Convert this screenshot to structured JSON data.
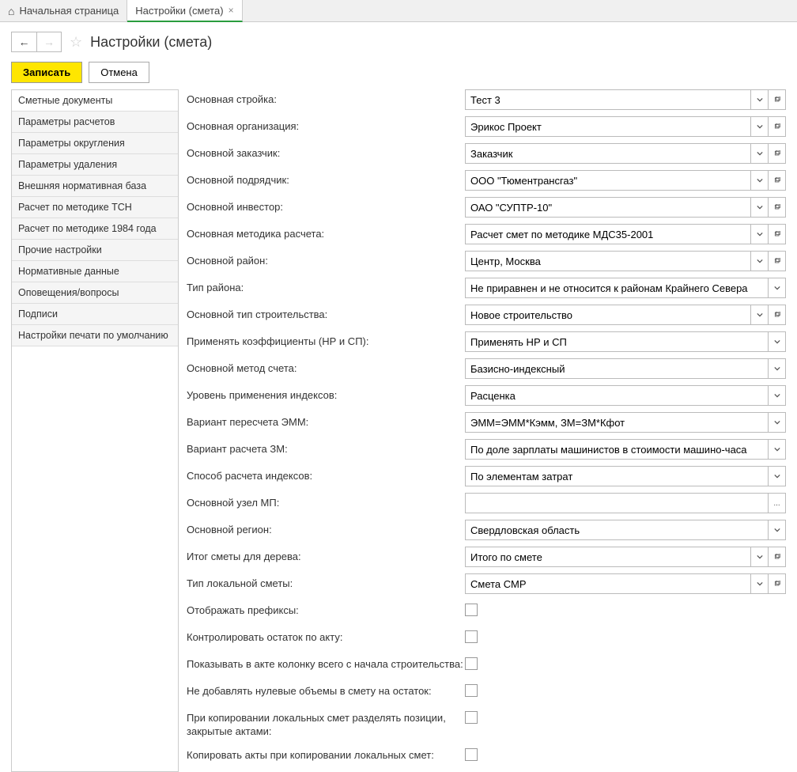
{
  "tabs": [
    {
      "label": "Начальная страница",
      "icon": "home"
    },
    {
      "label": "Настройки (смета)",
      "closable": true,
      "active": true
    }
  ],
  "pageTitle": "Настройки (смета)",
  "buttons": {
    "save": "Записать",
    "cancel": "Отмена"
  },
  "sidebar": [
    {
      "label": "Сметные документы",
      "active": true
    },
    {
      "label": "Параметры расчетов"
    },
    {
      "label": "Параметры округления"
    },
    {
      "label": "Параметры удаления"
    },
    {
      "label": "Внешняя нормативная база"
    },
    {
      "label": "Расчет по методике ТСН"
    },
    {
      "label": "Расчет по методике 1984 года"
    },
    {
      "label": "Прочие настройки"
    },
    {
      "label": "Нормативные данные"
    },
    {
      "label": "Оповещения/вопросы"
    },
    {
      "label": "Подписи"
    },
    {
      "label": "Настройки печати по умолчанию"
    }
  ],
  "fields": [
    {
      "label": "Основная стройка:",
      "value": "Тест 3",
      "type": "ref"
    },
    {
      "label": "Основная организация:",
      "value": "Эрикос Проект",
      "type": "ref"
    },
    {
      "label": "Основной заказчик:",
      "value": "Заказчик",
      "type": "ref"
    },
    {
      "label": "Основной подрядчик:",
      "value": "ООО \"Тюментрансгаз\"",
      "type": "ref"
    },
    {
      "label": "Основной инвестор:",
      "value": "ОАО \"СУПТР-10\"",
      "type": "ref"
    },
    {
      "label": "Основная методика расчета:",
      "value": "Расчет смет по методике МДС35-2001",
      "type": "ref"
    },
    {
      "label": "Основной район:",
      "value": "Центр, Москва",
      "type": "ref"
    },
    {
      "label": "Тип района:",
      "value": "Не приравнен и не относится к районам Крайнего Севера",
      "type": "select"
    },
    {
      "label": "Основной тип строительства:",
      "value": "Новое строительство",
      "type": "ref"
    },
    {
      "label": "Применять коэффициенты (НР и СП):",
      "value": "Применять НР и СП",
      "type": "select"
    },
    {
      "label": "Основной метод счета:",
      "value": "Базисно-индексный",
      "type": "select"
    },
    {
      "label": "Уровень применения индексов:",
      "value": "Расценка",
      "type": "select"
    },
    {
      "label": "Вариант пересчета ЭММ:",
      "value": "ЭММ=ЭММ*Кэмм, ЗМ=ЗМ*Кфот",
      "type": "select"
    },
    {
      "label": "Вариант расчета ЗМ:",
      "value": "По доле зарплаты машинистов в стоимости машино-часа",
      "type": "select"
    },
    {
      "label": "Способ расчета индексов:",
      "value": "По элементам затрат",
      "type": "select"
    },
    {
      "label": "Основной узел МП:",
      "value": "",
      "type": "ellipsis"
    },
    {
      "label": "Основной регион:",
      "value": "Свердловская область",
      "type": "select"
    },
    {
      "label": "Итог сметы для дерева:",
      "value": "Итого по смете",
      "type": "ref"
    },
    {
      "label": "Тип локальной сметы:",
      "value": "Смета СМР",
      "type": "ref"
    },
    {
      "label": "Отображать префиксы:",
      "type": "check"
    },
    {
      "label": "Контролировать остаток по акту:",
      "type": "check"
    },
    {
      "label": "Показывать в акте колонку всего с начала строительства:",
      "type": "check"
    },
    {
      "label": "Не добавлять нулевые объемы в смету на остаток:",
      "type": "check"
    },
    {
      "label": "При копировании локальных смет разделять позиции, закрытые актами:",
      "type": "check"
    },
    {
      "label": "Копировать акты при копировании локальных смет:",
      "type": "check"
    }
  ]
}
